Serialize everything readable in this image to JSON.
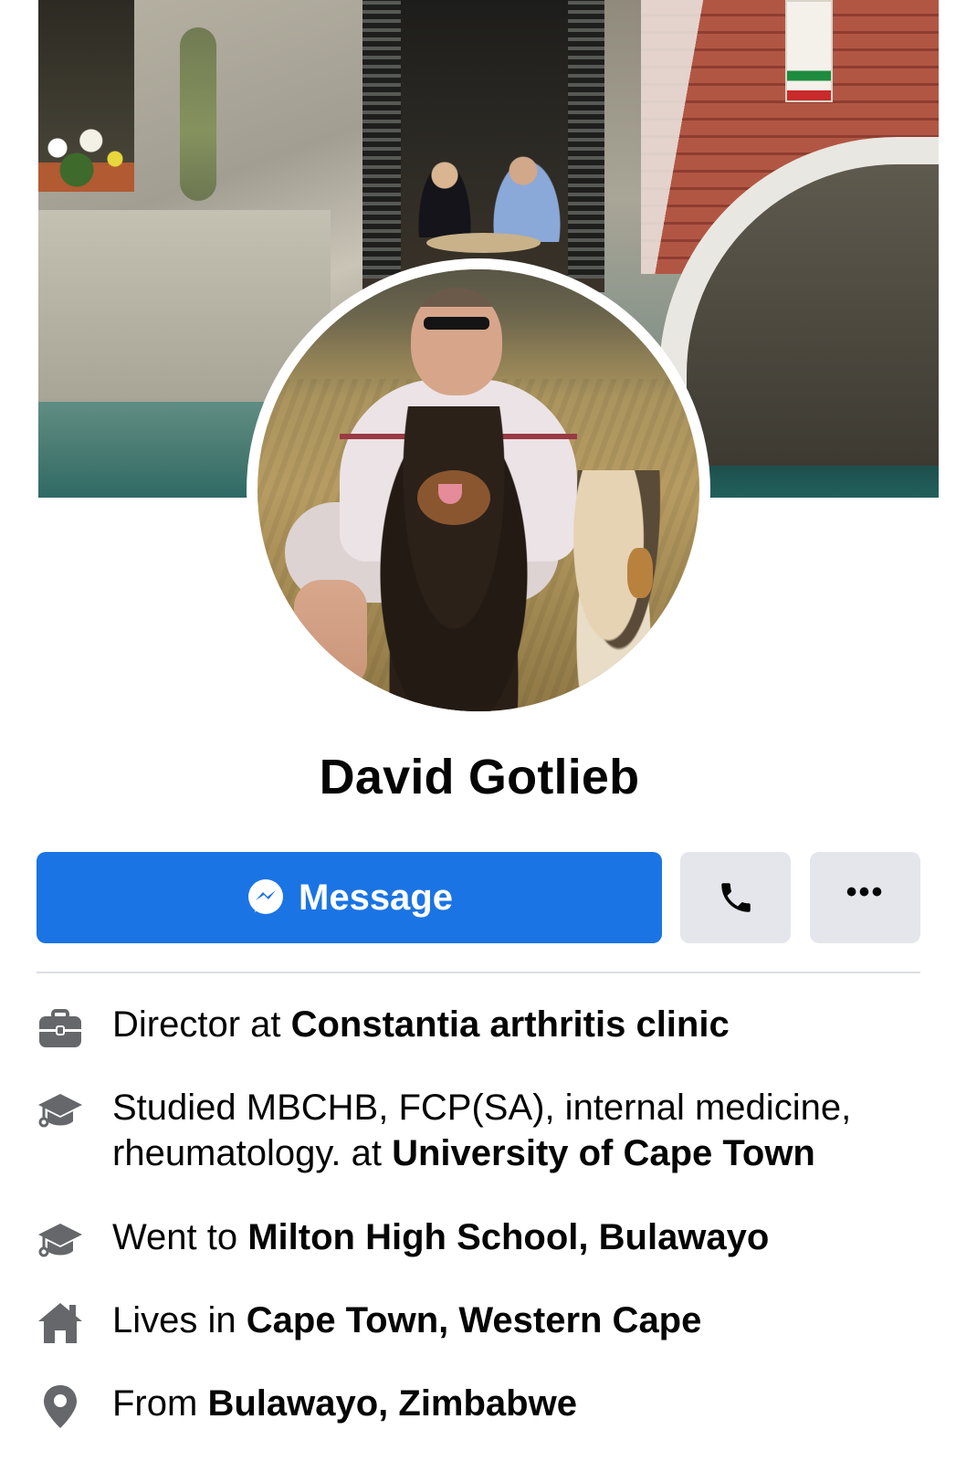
{
  "profile": {
    "name": "David Gotlieb"
  },
  "actions": {
    "message_label": "Message",
    "more_label": "•••"
  },
  "intro": [
    {
      "icon": "briefcase-icon",
      "prefix": "Director at ",
      "highlight": "Constantia arthritis clinic"
    },
    {
      "icon": "graduation-cap-icon",
      "prefix": "Studied MBCHB, FCP(SA), internal medicine, rheumatology. at ",
      "highlight": "University of Cape Town"
    },
    {
      "icon": "graduation-cap-icon",
      "prefix": "Went to ",
      "highlight": "Milton High School, Bulawayo"
    },
    {
      "icon": "home-icon",
      "prefix": "Lives in ",
      "highlight": "Cape Town, Western Cape"
    },
    {
      "icon": "location-pin-icon",
      "prefix": "From ",
      "highlight": "Bulawayo, Zimbabwe"
    }
  ],
  "colors": {
    "primary_button": "#1b74e4",
    "secondary_button": "#e4e6eb",
    "icon_gray": "#65676b",
    "text": "#050505"
  }
}
